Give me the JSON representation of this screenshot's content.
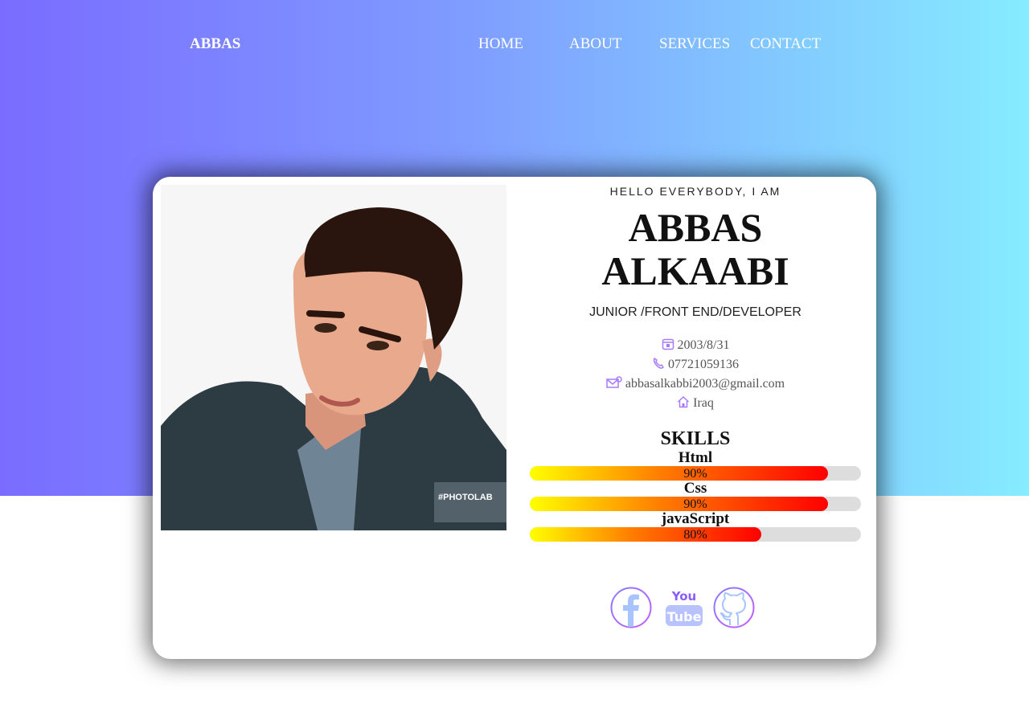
{
  "brand": "ABBAS",
  "nav": [
    "HOME",
    "ABOUT",
    "SERVICES",
    "CONTACT"
  ],
  "profile": {
    "greeting": "HELLO EVERYBODY, I AM",
    "first_name": "ABBAS",
    "last_name": "ALKAABI",
    "role": "JUNIOR /FRONT END/DEVELOPER",
    "birthday": "2003/8/31",
    "phone": "07721059136",
    "email": "abbasalkabbi2003@gmail.com",
    "country": "Iraq"
  },
  "skills": {
    "title": "SKILLS",
    "items": [
      {
        "name": "Html",
        "label": "90%",
        "level": 0.9
      },
      {
        "name": "Css",
        "label": "90%",
        "level": 0.9
      },
      {
        "name": "javaScript",
        "label": "80%",
        "level": 0.7
      }
    ]
  },
  "photo_watermark": "#PHOTOLAB",
  "socials": [
    "facebook-icon",
    "youtube-icon",
    "github-icon"
  ],
  "colors": {
    "hero_start": "#7a6cff",
    "hero_end": "#86ecff",
    "icon_accent": "#a77bff",
    "bar_start": "#ffff00",
    "bar_end": "#ff0000"
  }
}
